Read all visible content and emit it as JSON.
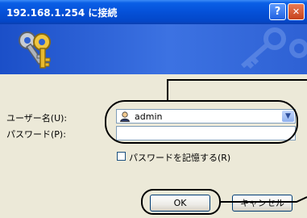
{
  "window": {
    "title": "192.168.1.254 に接続",
    "help_button": "?",
    "close_button": "✕"
  },
  "form": {
    "username_label": "ユーザー名(U):",
    "username_value": "admin",
    "password_label": "パスワード(P):",
    "password_value": "",
    "remember_label": "パスワードを記憶する(R)",
    "remember_checked": false
  },
  "buttons": {
    "ok": "OK",
    "cancel": "キャンセル"
  },
  "icons": {
    "banner": "keys-icon",
    "user": "user-icon",
    "dropdown": "chevron-down-icon"
  },
  "colors": {
    "titlebar": "#0550d8",
    "banner": "#2e61d4",
    "body": "#ece9d8",
    "annotation": "#000000"
  }
}
